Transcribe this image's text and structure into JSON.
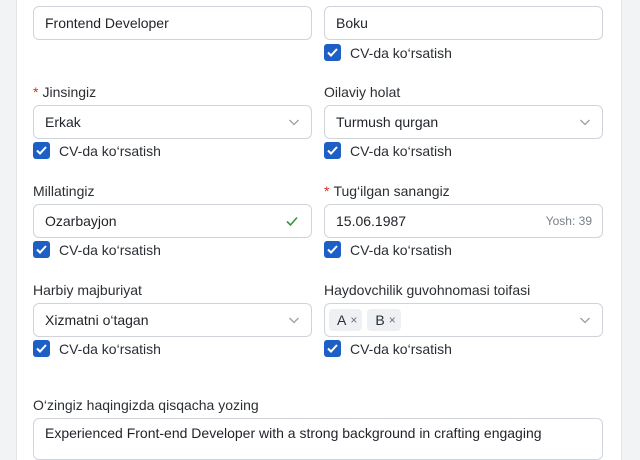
{
  "job_title": {
    "value": "Frontend Developer"
  },
  "city": {
    "value": "Boku",
    "show_cv": "CV-da ko‘rsatish"
  },
  "gender": {
    "label": "Jinsingiz",
    "required": "*",
    "value": "Erkak",
    "show_cv": "CV-da ko‘rsatish"
  },
  "marital": {
    "label": "Oilaviy holat",
    "value": "Turmush qurgan",
    "show_cv": "CV-da ko‘rsatish"
  },
  "nationality": {
    "label": "Millatingiz",
    "value": "Ozarbayjon",
    "show_cv": "CV-da ko‘rsatish"
  },
  "birthdate": {
    "label": "Tug‘ilgan sanangiz",
    "required": "*",
    "value": "15.06.1987",
    "age": "Yosh: 39",
    "show_cv": "CV-da ko‘rsatish"
  },
  "military": {
    "label": "Harbiy majburiyat",
    "value": "Xizmatni o‘tagan",
    "show_cv": "CV-da ko‘rsatish"
  },
  "license": {
    "label": "Haydovchilik guvohnomasi toifasi",
    "tags": [
      "A",
      "B"
    ],
    "remove": "×",
    "show_cv": "CV-da ko‘rsatish"
  },
  "about": {
    "label": "O‘zingiz haqingizda qisqacha yozing",
    "value": "Experienced Front-end Developer with a strong background in crafting engaging"
  },
  "colors": {
    "accent": "#1d5fc4",
    "valid": "#2e9a3e",
    "required": "#d92d20"
  }
}
